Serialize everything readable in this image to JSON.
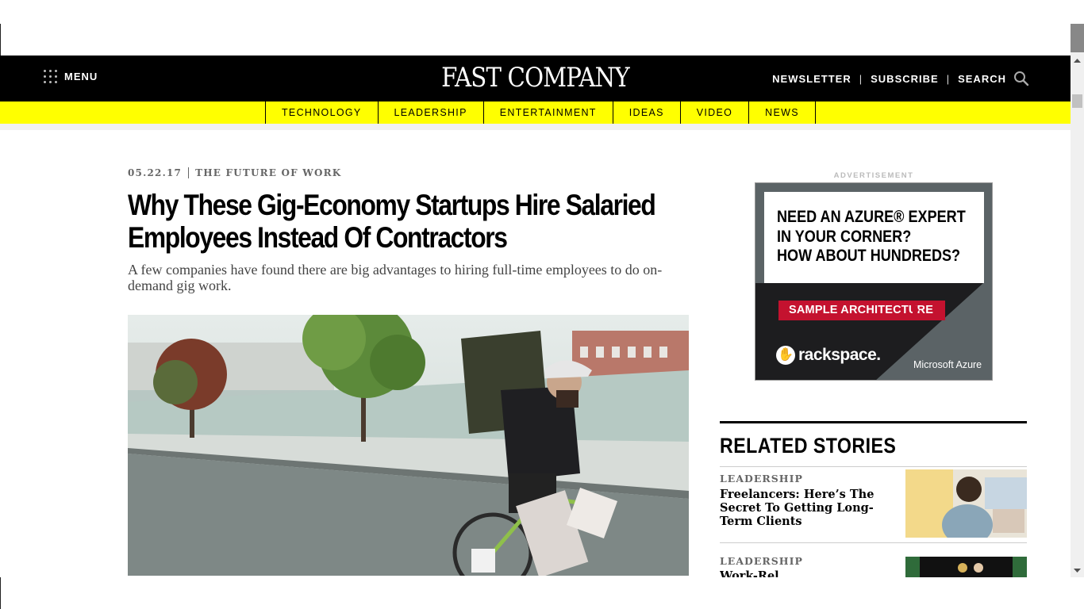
{
  "header": {
    "menu_label": "MENU",
    "logo_text": "FAST COMPANY",
    "newsletter": "NEWSLETTER",
    "subscribe": "SUBSCRIBE",
    "search": "SEARCH",
    "separator": "|"
  },
  "categories": [
    "TECHNOLOGY",
    "LEADERSHIP",
    "ENTERTAINMENT",
    "IDEAS",
    "VIDEO",
    "NEWS"
  ],
  "article": {
    "date": "05.22.17",
    "section": "THE FUTURE OF WORK",
    "headline": "Why These Gig-Economy Startups Hire Salaried Employees Instead Of Contractors",
    "dek": "A few companies have found there are big advantages to hiring full-time employees to do on-demand gig work."
  },
  "ad": {
    "label": "ADVERTISEMENT",
    "line1": "NEED AN AZURE® EXPERT",
    "line2": "IN YOUR CORNER?",
    "line3": "HOW ABOUT HUNDREDS?",
    "cta": "SAMPLE ARCHITECTURE",
    "brand": "rackspace.",
    "partner": "Microsoft Azure"
  },
  "related": {
    "heading": "RELATED STORIES",
    "stories": [
      {
        "kicker": "LEADERSHIP",
        "title": "Freelancers: Here’s The Secret To Getting Long-Term Clients"
      },
      {
        "kicker": "LEADERSHIP",
        "title": "Work-Rel..."
      }
    ]
  },
  "colors": {
    "header_bg": "#000000",
    "category_bar": "#ffff00",
    "ad_cta": "#c4122f"
  },
  "icons": {
    "menu": "grid-dots-icon",
    "search": "magnifier-icon"
  }
}
